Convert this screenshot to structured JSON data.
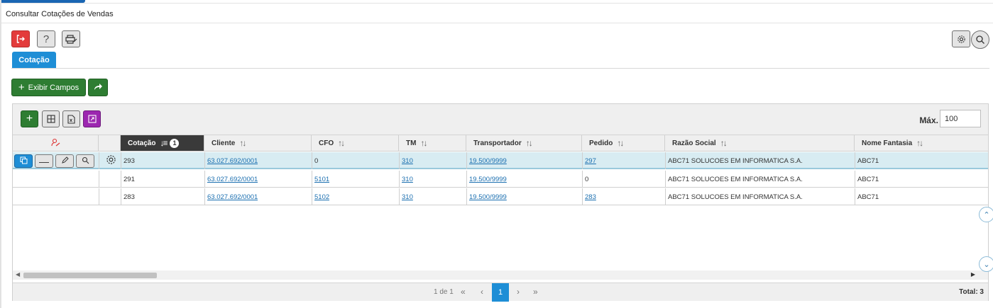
{
  "page": {
    "title": "Consultar Cotações de Vendas"
  },
  "toolbar": {
    "exit_icon": "exit-icon",
    "help_icon": "help-icon",
    "print_icon": "print-icon",
    "settings_icon": "gear-icon",
    "search_icon": "search-icon"
  },
  "tabs": [
    {
      "label": "Cotação",
      "active": true
    }
  ],
  "actions": {
    "show_fields_label": "Exibir Campos"
  },
  "grid": {
    "max_label": "Máx.",
    "max_value": "100",
    "columns": [
      {
        "label": "Cotação",
        "sorted": true,
        "sort_badge": "1"
      },
      {
        "label": "Cliente"
      },
      {
        "label": "CFO"
      },
      {
        "label": "TM"
      },
      {
        "label": "Transportador"
      },
      {
        "label": "Pedido"
      },
      {
        "label": "Razão Social"
      },
      {
        "label": "Nome Fantasia"
      }
    ],
    "rows": [
      {
        "cotacao": "293",
        "cliente": "63.027.692/0001",
        "cfo": "0",
        "tm": "310",
        "transportador": "19.500/9999",
        "pedido": "297",
        "razao_social": "ABC71 SOLUCOES EM INFORMATICA S.A.",
        "nome_fantasia": "ABC71",
        "selected": true
      },
      {
        "cotacao": "291",
        "cliente": "63.027.692/0001",
        "cfo": "5101",
        "tm": "310",
        "transportador": "19.500/9999",
        "pedido": "0",
        "razao_social": "ABC71 SOLUCOES EM INFORMATICA S.A.",
        "nome_fantasia": "ABC71",
        "selected": false
      },
      {
        "cotacao": "283",
        "cliente": "63.027.692/0001",
        "cfo": "5102",
        "tm": "310",
        "transportador": "19.500/9999",
        "pedido": "283",
        "razao_social": "ABC71 SOLUCOES EM INFORMATICA S.A.",
        "nome_fantasia": "ABC71",
        "selected": false
      }
    ]
  },
  "pager": {
    "page_info": "1 de 1",
    "current_page": "1",
    "total": "Total: 3"
  },
  "colors": {
    "accent": "#1e8ed6",
    "green": "#2e7d32",
    "red": "#e33b3b",
    "purple": "#9c27b0",
    "selected_row": "#d8ecf2"
  }
}
